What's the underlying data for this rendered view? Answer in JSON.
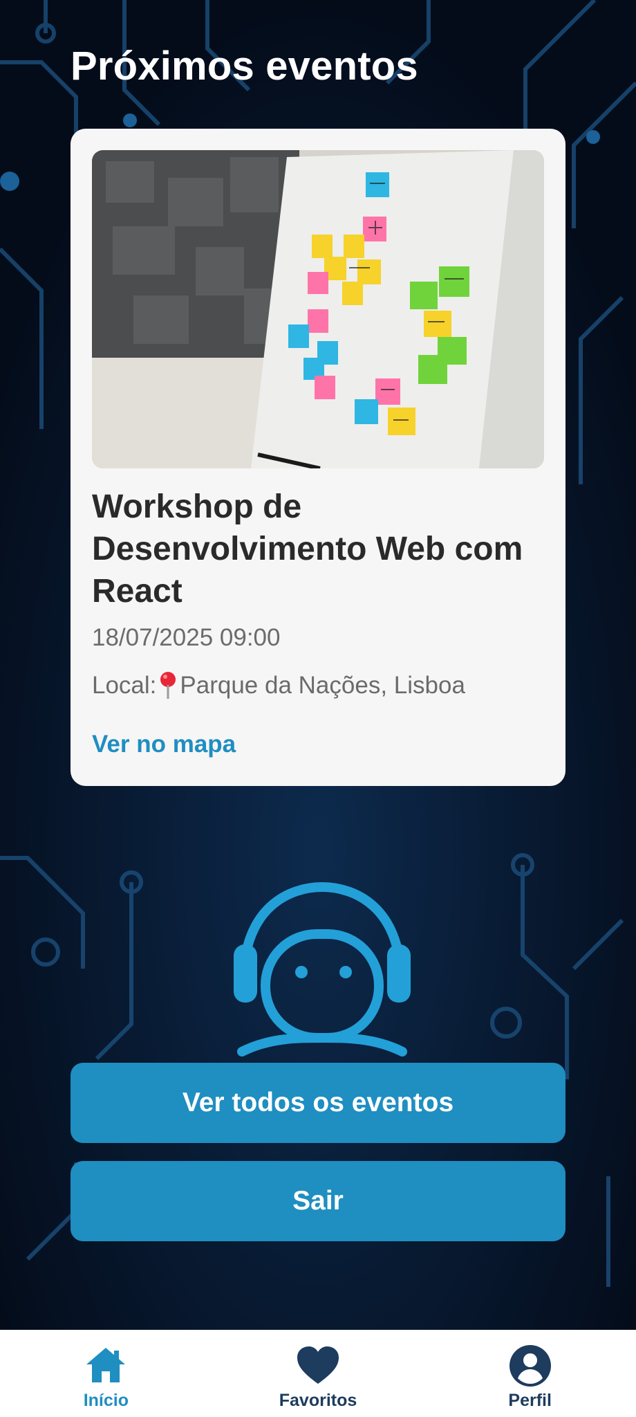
{
  "header": {
    "title": "Próximos eventos"
  },
  "event_card": {
    "title": "Workshop de Desenvolvimento Web com React",
    "datetime": "18/07/2025 09:00",
    "location_label": "Local:",
    "location": "Parque da Nações, Lisboa",
    "map_link": "Ver no mapa"
  },
  "actions": {
    "all_events_label": "Ver todos os eventos",
    "logout_label": "Sair"
  },
  "bottom_nav": {
    "items": [
      {
        "label": "Início",
        "icon": "home-icon",
        "active": true
      },
      {
        "label": "Favoritos",
        "icon": "heart-icon",
        "active": false
      },
      {
        "label": "Perfil",
        "icon": "user-circle-icon",
        "active": false
      }
    ]
  },
  "colors": {
    "accent": "#1f8ec1",
    "background": "#061226",
    "nav_inactive": "#1d3c5e"
  }
}
